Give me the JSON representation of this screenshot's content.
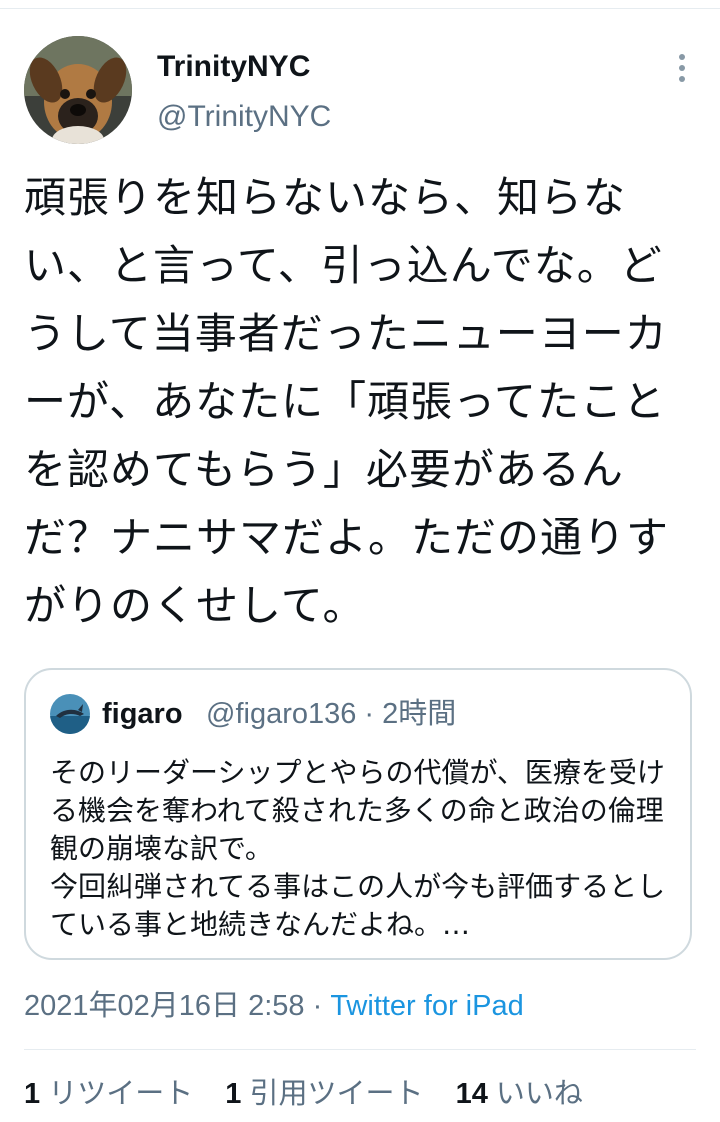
{
  "author": {
    "name": "TrinityNYC",
    "handle": "@TrinityNYC"
  },
  "tweet": {
    "text": "頑張りを知らないなら、知らない、と言って、引っ込んでな。どうして当事者だったニューヨーカーが、あなたに「頑張ってたことを認めてもらう」必要があるんだ？ナニサマだよ。ただの通りすがりのくせして。"
  },
  "quote": {
    "name": "figaro",
    "meta": "@figaro136 · 2時間",
    "text": "そのリーダーシップとやらの代償が、医療を受ける機会を奪われて殺された多くの命と政治の倫理観の崩壊な訳で。\n今回糾弾されてる事はこの人が今も評価するとしている事と地続きなんだよね。…"
  },
  "footer": {
    "timestamp": "2021年02月16日 2:58",
    "separator": " · ",
    "source": "Twitter for iPad"
  },
  "stats": [
    {
      "count": "1",
      "label": "リツイート"
    },
    {
      "count": "1",
      "label": "引用ツイート"
    },
    {
      "count": "14",
      "label": "いいね"
    }
  ],
  "colors": {
    "primary_text": "#0f1419",
    "secondary_text": "#5b7083",
    "link": "#1b95e0",
    "border": "#cfd9de"
  },
  "icons": {
    "more": "more-vertical-icon"
  }
}
